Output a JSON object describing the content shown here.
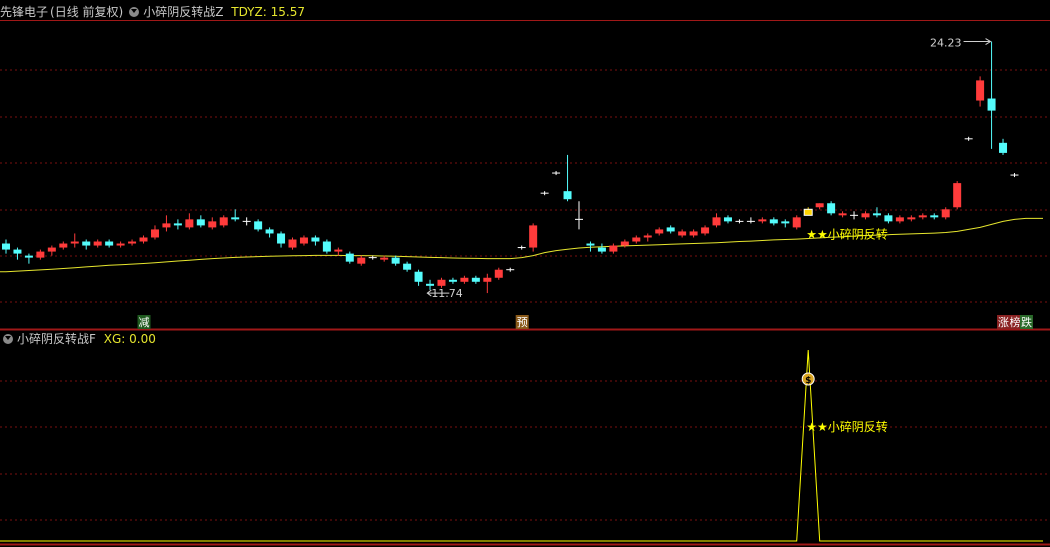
{
  "top_header": {
    "stock": "先锋电子",
    "period": "(日线 前复权)",
    "indicator_name": "小碎阴反转战Z",
    "value_label": "TDYZ:",
    "value": "15.57"
  },
  "bottom_header": {
    "indicator_name": "小碎阴反转战F",
    "value_label": "XG:",
    "value": "0.00"
  },
  "colors": {
    "up": "#ff3b3b",
    "down": "#54fcfc",
    "ma": "#e6e62e",
    "signal_bar": "#ffd400",
    "grid": "#7a1010",
    "axis": "#a01818",
    "xg_line": "#ffff00"
  },
  "chart_data": [
    {
      "type": "candlestick",
      "series": [
        {
          "name": "TDYZ"
        }
      ],
      "price_range": [
        10.8,
        25.2
      ],
      "annotations": {
        "high": "24.23",
        "low": "11.74",
        "signal": "★★小碎阴反转",
        "markers": [
          {
            "text": "减",
            "index": 12,
            "bg": "#1f5a1f",
            "fg": "#ffffff"
          },
          {
            "text": "预",
            "index": 45,
            "bg": "#8a5a1a",
            "fg": "#ffffff"
          },
          {
            "text": "涨",
            "index": 87,
            "bg": "#8a2222",
            "fg": "#ffffff"
          },
          {
            "text": "榜",
            "index": 88,
            "bg": "#8a2222",
            "fg": "#ffffff"
          },
          {
            "text": "跌",
            "index": 89,
            "bg": "#2a6a2a",
            "fg": "#ffffff"
          }
        ]
      },
      "candles": [
        [
          14.2,
          13.9,
          14.4,
          13.7
        ],
        [
          13.9,
          13.7,
          14.0,
          13.4
        ],
        [
          13.6,
          13.5,
          13.7,
          13.2
        ],
        [
          13.5,
          13.8,
          13.9,
          13.4
        ],
        [
          13.8,
          14.0,
          14.1,
          13.6
        ],
        [
          14.0,
          14.2,
          14.3,
          13.9
        ],
        [
          14.2,
          14.3,
          14.7,
          14.0
        ],
        [
          14.3,
          14.1,
          14.4,
          13.9
        ],
        [
          14.1,
          14.3,
          14.4,
          14.0
        ],
        [
          14.3,
          14.1,
          14.4,
          14.0
        ],
        [
          14.1,
          14.2,
          14.3,
          14.0
        ],
        [
          14.2,
          14.3,
          14.4,
          14.1
        ],
        [
          14.3,
          14.5,
          14.6,
          14.2
        ],
        [
          14.5,
          14.9,
          15.1,
          14.4
        ],
        [
          15.0,
          15.2,
          15.6,
          14.8
        ],
        [
          15.2,
          15.1,
          15.4,
          14.9
        ],
        [
          15.0,
          15.4,
          15.7,
          14.9
        ],
        [
          15.4,
          15.1,
          15.6,
          15.0
        ],
        [
          15.0,
          15.3,
          15.5,
          14.9
        ],
        [
          15.1,
          15.5,
          15.6,
          15.0
        ],
        [
          15.5,
          15.4,
          15.9,
          15.3
        ],
        [
          15.3,
          15.3,
          15.5,
          15.1
        ],
        [
          15.3,
          14.9,
          15.4,
          14.8
        ],
        [
          14.9,
          14.7,
          15.0,
          14.5
        ],
        [
          14.7,
          14.2,
          14.8,
          14.0
        ],
        [
          14.0,
          14.4,
          14.5,
          13.9
        ],
        [
          14.2,
          14.5,
          14.6,
          14.1
        ],
        [
          14.5,
          14.3,
          14.6,
          14.1
        ],
        [
          14.3,
          13.8,
          14.4,
          13.7
        ],
        [
          13.8,
          13.9,
          14.0,
          13.6
        ],
        [
          13.7,
          13.3,
          13.8,
          13.2
        ],
        [
          13.2,
          13.5,
          13.6,
          13.1
        ],
        [
          13.5,
          13.5,
          13.6,
          13.4
        ],
        [
          13.4,
          13.5,
          13.6,
          13.3
        ],
        [
          13.5,
          13.2,
          13.6,
          13.1
        ],
        [
          13.2,
          12.9,
          13.3,
          12.8
        ],
        [
          12.8,
          12.3,
          12.9,
          12.1
        ],
        [
          12.2,
          12.1,
          12.4,
          11.9
        ],
        [
          12.1,
          12.4,
          12.5,
          12.0
        ],
        [
          12.4,
          12.3,
          12.5,
          12.2
        ],
        [
          12.3,
          12.5,
          12.6,
          12.2
        ],
        [
          12.5,
          12.3,
          12.6,
          12.2
        ],
        [
          12.3,
          12.5,
          12.7,
          11.74
        ],
        [
          12.5,
          12.9,
          13.0,
          12.4
        ],
        [
          12.9,
          12.9,
          13.0,
          12.8
        ],
        [
          14.0,
          14.0,
          14.1,
          13.9
        ],
        [
          14.0,
          15.1,
          15.2,
          13.8
        ],
        [
          16.7,
          16.7,
          16.8,
          16.6
        ],
        [
          17.7,
          17.7,
          17.8,
          17.6
        ],
        [
          16.8,
          16.4,
          18.6,
          16.3
        ],
        [
          15.4,
          15.4,
          16.3,
          14.9
        ],
        [
          14.2,
          14.1,
          14.3,
          13.8
        ],
        [
          14.0,
          13.8,
          14.2,
          13.7
        ],
        [
          13.8,
          14.1,
          14.2,
          13.7
        ],
        [
          14.1,
          14.3,
          14.4,
          14.0
        ],
        [
          14.3,
          14.5,
          14.6,
          14.2
        ],
        [
          14.5,
          14.6,
          14.7,
          14.3
        ],
        [
          14.7,
          14.9,
          15.0,
          14.6
        ],
        [
          15.0,
          14.8,
          15.1,
          14.7
        ],
        [
          14.6,
          14.8,
          14.9,
          14.5
        ],
        [
          14.6,
          14.8,
          14.9,
          14.5
        ],
        [
          14.7,
          15.0,
          15.1,
          14.6
        ],
        [
          15.1,
          15.5,
          15.7,
          15.0
        ],
        [
          15.5,
          15.3,
          15.6,
          15.2
        ],
        [
          15.3,
          15.3,
          15.4,
          15.2
        ],
        [
          15.3,
          15.3,
          15.5,
          15.2
        ],
        [
          15.3,
          15.4,
          15.5,
          15.2
        ],
        [
          15.4,
          15.2,
          15.5,
          15.1
        ],
        [
          15.3,
          15.2,
          15.4,
          15.0
        ],
        [
          15.0,
          15.5,
          15.6,
          14.9
        ],
        [
          15.6,
          15.9,
          16.0,
          15.6
        ],
        [
          16.0,
          16.2,
          16.2,
          15.9
        ],
        [
          16.2,
          15.7,
          16.3,
          15.6
        ],
        [
          15.6,
          15.7,
          15.8,
          15.5
        ],
        [
          15.6,
          15.6,
          15.8,
          15.4
        ],
        [
          15.5,
          15.7,
          15.8,
          15.4
        ],
        [
          15.7,
          15.6,
          16.0,
          15.5
        ],
        [
          15.6,
          15.3,
          15.7,
          15.2
        ],
        [
          15.3,
          15.5,
          15.6,
          15.2
        ],
        [
          15.4,
          15.5,
          15.6,
          15.3
        ],
        [
          15.5,
          15.6,
          15.7,
          15.4
        ],
        [
          15.6,
          15.5,
          15.7,
          15.4
        ],
        [
          15.5,
          15.9,
          16.0,
          15.4
        ],
        [
          16.0,
          17.2,
          17.3,
          15.9
        ],
        [
          19.4,
          19.4,
          19.5,
          19.3
        ],
        [
          21.3,
          22.3,
          22.5,
          21.0
        ],
        [
          21.4,
          20.8,
          24.23,
          18.9
        ],
        [
          19.2,
          18.7,
          19.4,
          18.6
        ],
        [
          17.6,
          17.6,
          17.7,
          17.5
        ]
      ],
      "ma": [
        12.8,
        12.83,
        12.86,
        12.89,
        12.92,
        12.96,
        13.0,
        13.04,
        13.08,
        13.12,
        13.15,
        13.18,
        13.21,
        13.25,
        13.29,
        13.33,
        13.37,
        13.41,
        13.45,
        13.48,
        13.51,
        13.53,
        13.55,
        13.57,
        13.58,
        13.59,
        13.6,
        13.61,
        13.61,
        13.61,
        13.6,
        13.6,
        13.59,
        13.58,
        13.57,
        13.55,
        13.53,
        13.51,
        13.5,
        13.48,
        13.47,
        13.46,
        13.45,
        13.45,
        13.45,
        13.5,
        13.6,
        13.75,
        13.85,
        13.92,
        13.98,
        14.02,
        14.04,
        14.06,
        14.08,
        14.1,
        14.12,
        14.14,
        14.16,
        14.18,
        14.2,
        14.22,
        14.24,
        14.27,
        14.3,
        14.32,
        14.35,
        14.38,
        14.4,
        14.42,
        14.45,
        14.48,
        14.51,
        14.54,
        14.57,
        14.6,
        14.62,
        14.64,
        14.66,
        14.68,
        14.7,
        14.72,
        14.75,
        14.8,
        14.9,
        15.0,
        15.15,
        15.3,
        15.4,
        15.45
      ],
      "signal_index": 70
    },
    {
      "type": "line",
      "series": [
        {
          "name": "XG"
        }
      ],
      "spike_index": 70,
      "spike_value": 1,
      "labels": {
        "signal": "★★小碎阴反转",
        "coin": "$"
      }
    }
  ]
}
